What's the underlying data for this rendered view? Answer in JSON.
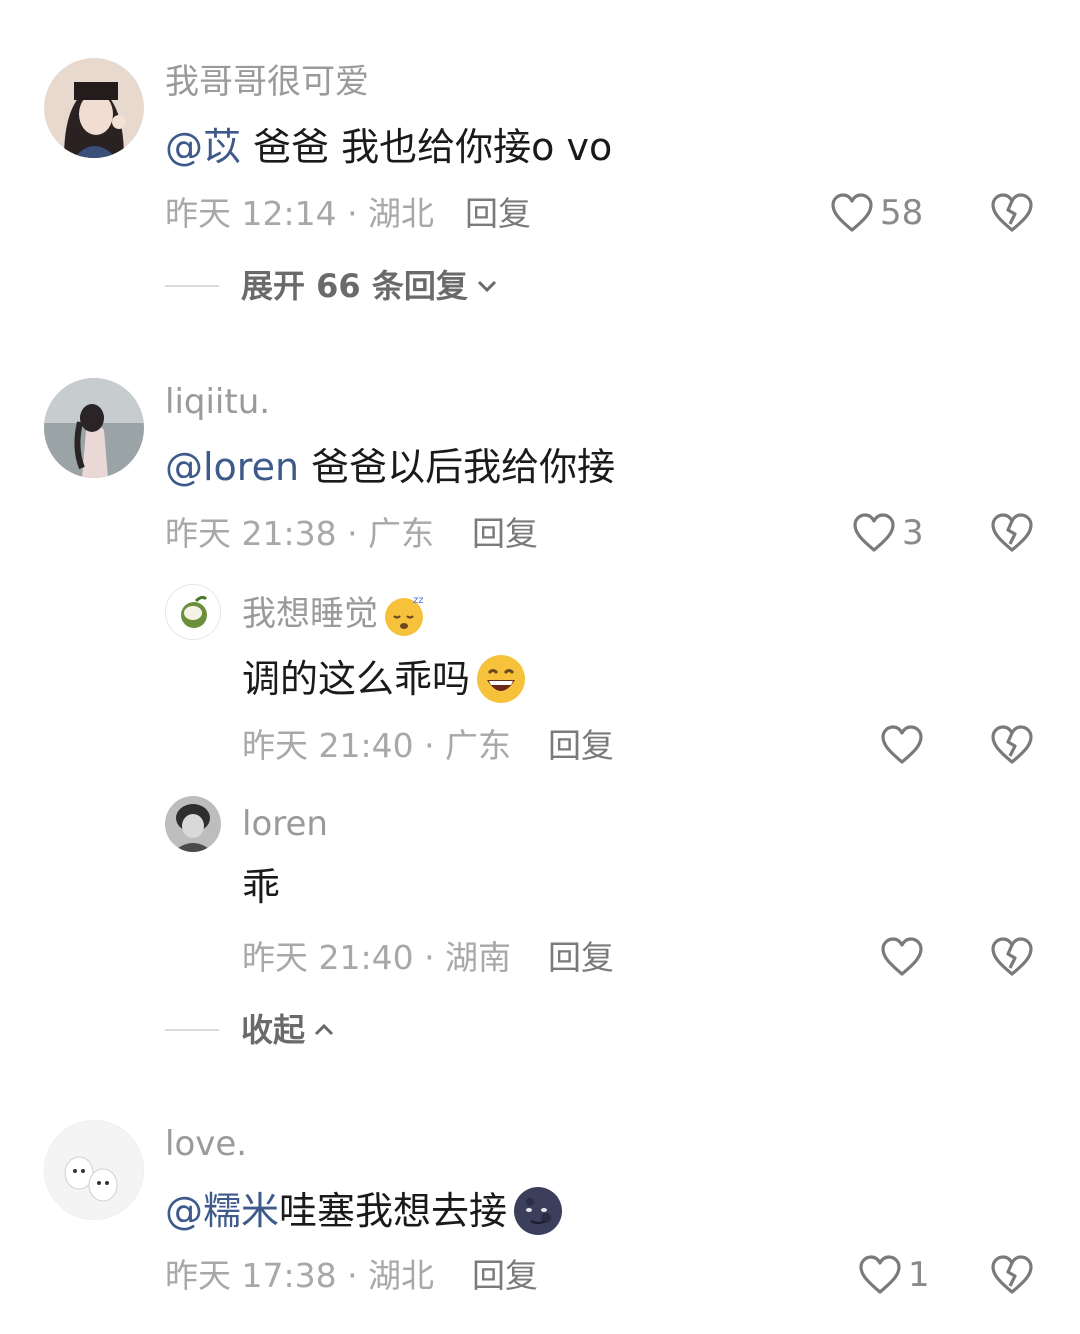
{
  "comments": [
    {
      "username": "我哥哥很可爱",
      "mention": "@苡",
      "text": " 爸爸 我也给你接o vo",
      "meta": "昨天 12:14 · 湖北",
      "reply_label": "回复",
      "likes": "58",
      "expand_label": "展开 66 条回复"
    },
    {
      "username": "liqiitu.",
      "mention": "@loren",
      "text": " 爸爸以后我给你接",
      "meta": "昨天 21:38 · 广东",
      "reply_label": "回复",
      "likes": "3",
      "replies": [
        {
          "username": "我想睡觉",
          "text": "调的这么乖吗",
          "meta": "昨天 21:40 · 广东",
          "reply_label": "回复"
        },
        {
          "username": "loren",
          "text": "乖",
          "meta": "昨天 21:40 · 湖南",
          "reply_label": "回复"
        }
      ],
      "collapse_label": "收起"
    },
    {
      "username": "love.",
      "mention": "@糯米",
      "text": " 哇塞我想去接",
      "meta": "昨天 17:38 · 湖北",
      "reply_label": "回复",
      "likes": "1"
    }
  ],
  "icons": {
    "like": "heart-outline-icon",
    "dislike": "broken-heart-icon",
    "expand": "chevron-down-icon",
    "collapse": "chevron-up-icon"
  },
  "colors": {
    "mention": "#3d5a8a",
    "meta": "#a8a8a8",
    "text": "#1a1a1a"
  }
}
